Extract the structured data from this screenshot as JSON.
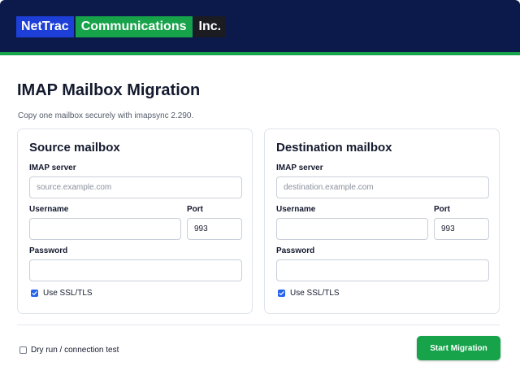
{
  "header": {
    "logo_parts": [
      "NetTrac",
      "Communications",
      "Inc."
    ]
  },
  "page": {
    "title": "IMAP Mailbox Migration",
    "subtitle": "Copy one mailbox securely with imapsync 2.290."
  },
  "source": {
    "title": "Source mailbox",
    "server_label": "IMAP server",
    "server_placeholder": "source.example.com",
    "username_label": "Username",
    "username_value": "",
    "port_label": "Port",
    "port_value": "993",
    "password_label": "Password",
    "password_value": "",
    "ssl_label": "Use SSL/TLS",
    "ssl_checked": true
  },
  "destination": {
    "title": "Destination mailbox",
    "server_label": "IMAP server",
    "server_placeholder": "destination.example.com",
    "username_label": "Username",
    "username_value": "",
    "port_label": "Port",
    "port_value": "993",
    "password_label": "Password",
    "password_value": "",
    "ssl_label": "Use SSL/TLS",
    "ssl_checked": true
  },
  "footer": {
    "dry_run_label": "Dry run / connection test",
    "dry_run_checked": false,
    "start_label": "Start Migration"
  },
  "colors": {
    "header_bg": "#0b1a4a",
    "accent_green": "#16a34a",
    "logo_blue": "#1d3fd8",
    "checkbox_blue": "#2563eb"
  }
}
